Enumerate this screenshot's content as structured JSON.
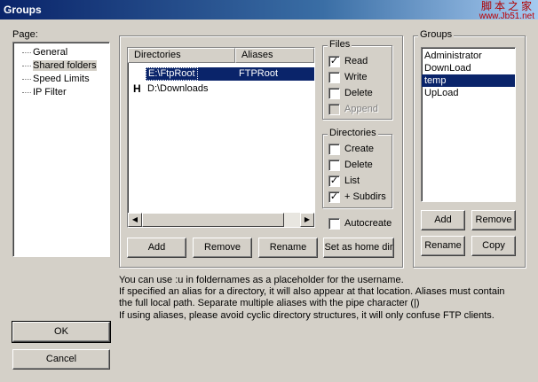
{
  "window": {
    "title": "Groups"
  },
  "watermark": {
    "chinese": "脚本之家",
    "url": "www.Jb51.net"
  },
  "page_panel": {
    "label": "Page:",
    "items": [
      "General",
      "Shared folders",
      "Speed Limits",
      "IP Filter"
    ],
    "selected_index": 1
  },
  "directories": {
    "columns": [
      "Directories",
      "Aliases"
    ],
    "rows": [
      {
        "marker": "",
        "path": "E:\\FtpRoot",
        "alias": "FTPRoot",
        "selected": true
      },
      {
        "marker": "H",
        "path": "D:\\Downloads",
        "alias": "",
        "selected": false
      }
    ],
    "buttons": {
      "add": "Add",
      "remove": "Remove",
      "rename": "Rename",
      "home": "Set as home dir"
    }
  },
  "files": {
    "label": "Files",
    "read": {
      "label": "Read",
      "checked": true
    },
    "write": {
      "label": "Write",
      "checked": false
    },
    "delete": {
      "label": "Delete",
      "checked": false
    },
    "append": {
      "label": "Append",
      "checked": false,
      "disabled": true
    }
  },
  "dirs_perm": {
    "label": "Directories",
    "create": {
      "label": "Create",
      "checked": false
    },
    "delete": {
      "label": "Delete",
      "checked": false
    },
    "list": {
      "label": "List",
      "checked": true
    },
    "subdirs": {
      "label": "+ Subdirs",
      "checked": true
    }
  },
  "autocreate": {
    "label": "Autocreate",
    "checked": false
  },
  "groups": {
    "label": "Groups",
    "items": [
      "Administrator",
      "DownLoad",
      "temp",
      "UpLoad"
    ],
    "selected_index": 2,
    "buttons": {
      "add": "Add",
      "remove": "Remove",
      "rename": "Rename",
      "copy": "Copy"
    }
  },
  "help": {
    "line1": "You can use :u in foldernames as a placeholder for the username.",
    "line2": "If specified an alias for a directory, it will also appear at that location. Aliases must contain the full local path. Separate multiple aliases with the pipe character (|)",
    "line3": "If using aliases, please avoid cyclic directory structures, it will only confuse FTP clients."
  },
  "dialog_buttons": {
    "ok": "OK",
    "cancel": "Cancel"
  }
}
